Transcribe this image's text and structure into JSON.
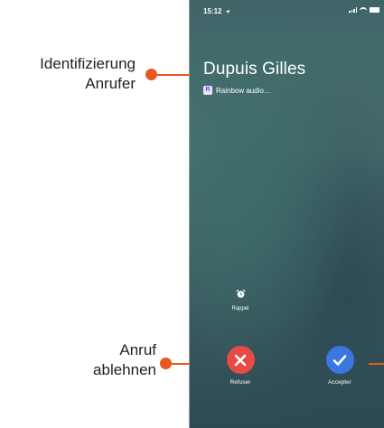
{
  "annotations": {
    "caller_line1": "Identifizierung",
    "caller_line2": "Anrufer",
    "decline_line1": "Anruf",
    "decline_line2": "ablehnen"
  },
  "status_bar": {
    "time": "15:12"
  },
  "call": {
    "caller_name": "Dupuis Gilles",
    "app_label": "Rainbow audio…",
    "app_icon_letter": "R"
  },
  "actions": {
    "reminder_label": "Rappel",
    "decline_label": "Refuser",
    "accept_label": "Accepter"
  },
  "colors": {
    "annotation_accent": "#e8571f",
    "decline": "#e84a45",
    "accept": "#3a78e0"
  }
}
